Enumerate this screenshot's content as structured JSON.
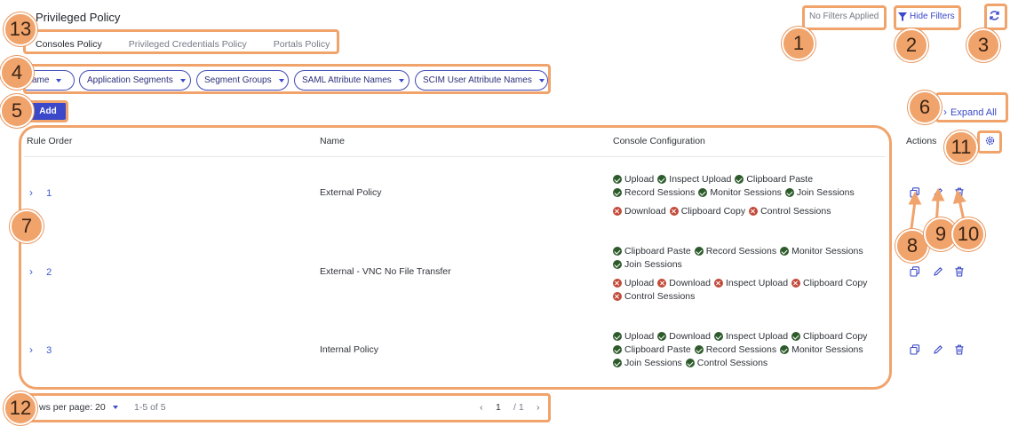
{
  "header": {
    "title": "Privileged Policy",
    "tabs": [
      {
        "label": "Consoles Policy",
        "active": true
      },
      {
        "label": "Privileged Credentials Policy",
        "active": false
      },
      {
        "label": "Portals Policy",
        "active": false
      }
    ],
    "no_filters_label": "No Filters Applied",
    "hide_filters_label": "Hide Filters",
    "refresh_icon": "refresh-icon"
  },
  "filters": [
    {
      "label": "ame"
    },
    {
      "label": "Application Segments"
    },
    {
      "label": "Segment Groups"
    },
    {
      "label": "SAML Attribute Names"
    },
    {
      "label": "SCIM User Attribute Names"
    }
  ],
  "toolbar": {
    "add_label": "Add",
    "expand_all_label": "Expand All"
  },
  "table": {
    "columns": {
      "rule_order": "Rule Order",
      "name": "Name",
      "console_config": "Console Configuration",
      "actions": "Actions"
    },
    "rows": [
      {
        "order": "1",
        "name": "External Policy",
        "lines": [
          [
            {
              "s": "ok",
              "t": "Upload"
            },
            {
              "s": "ok",
              "t": "Inspect Upload"
            },
            {
              "s": "ok",
              "t": "Clipboard Paste"
            }
          ],
          [
            {
              "s": "ok",
              "t": "Record Sessions"
            },
            {
              "s": "ok",
              "t": "Monitor Sessions"
            },
            {
              "s": "ok",
              "t": "Join Sessions"
            }
          ],
          [
            {
              "s": "no",
              "t": "Download"
            },
            {
              "s": "no",
              "t": "Clipboard Copy"
            },
            {
              "s": "no",
              "t": "Control Sessions"
            }
          ]
        ]
      },
      {
        "order": "2",
        "name": "External - VNC No File Transfer",
        "lines": [
          [
            {
              "s": "ok",
              "t": "Clipboard Paste"
            },
            {
              "s": "ok",
              "t": "Record Sessions"
            },
            {
              "s": "ok",
              "t": "Monitor Sessions"
            }
          ],
          [
            {
              "s": "ok",
              "t": "Join Sessions"
            }
          ],
          [
            {
              "s": "no",
              "t": "Upload"
            },
            {
              "s": "no",
              "t": "Download"
            },
            {
              "s": "no",
              "t": "Inspect Upload"
            },
            {
              "s": "no",
              "t": "Clipboard Copy"
            }
          ],
          [
            {
              "s": "no",
              "t": "Control Sessions"
            }
          ]
        ]
      },
      {
        "order": "3",
        "name": "Internal Policy",
        "lines": [
          [
            {
              "s": "ok",
              "t": "Upload"
            },
            {
              "s": "ok",
              "t": "Download"
            },
            {
              "s": "ok",
              "t": "Inspect Upload"
            },
            {
              "s": "ok",
              "t": "Clipboard Copy"
            }
          ],
          [
            {
              "s": "ok",
              "t": "Clipboard Paste"
            },
            {
              "s": "ok",
              "t": "Record Sessions"
            },
            {
              "s": "ok",
              "t": "Monitor Sessions"
            }
          ],
          [
            {
              "s": "ok",
              "t": "Join Sessions"
            },
            {
              "s": "ok",
              "t": "Control Sessions"
            }
          ]
        ]
      }
    ]
  },
  "pagination": {
    "rows_per_page_label": "ws per page:",
    "rows_per_page_value": "20",
    "range_label": "1-5 of 5",
    "current_page": "1",
    "total_pages": "/  1"
  },
  "callouts": [
    "1",
    "2",
    "3",
    "4",
    "5",
    "6",
    "7",
    "8",
    "9",
    "10",
    "11",
    "12",
    "13"
  ],
  "colors": {
    "accent": "#3a48c9",
    "annotation": "#f0a36b",
    "enabled": "#2d5b2b",
    "disabled": "#c34a3a"
  }
}
